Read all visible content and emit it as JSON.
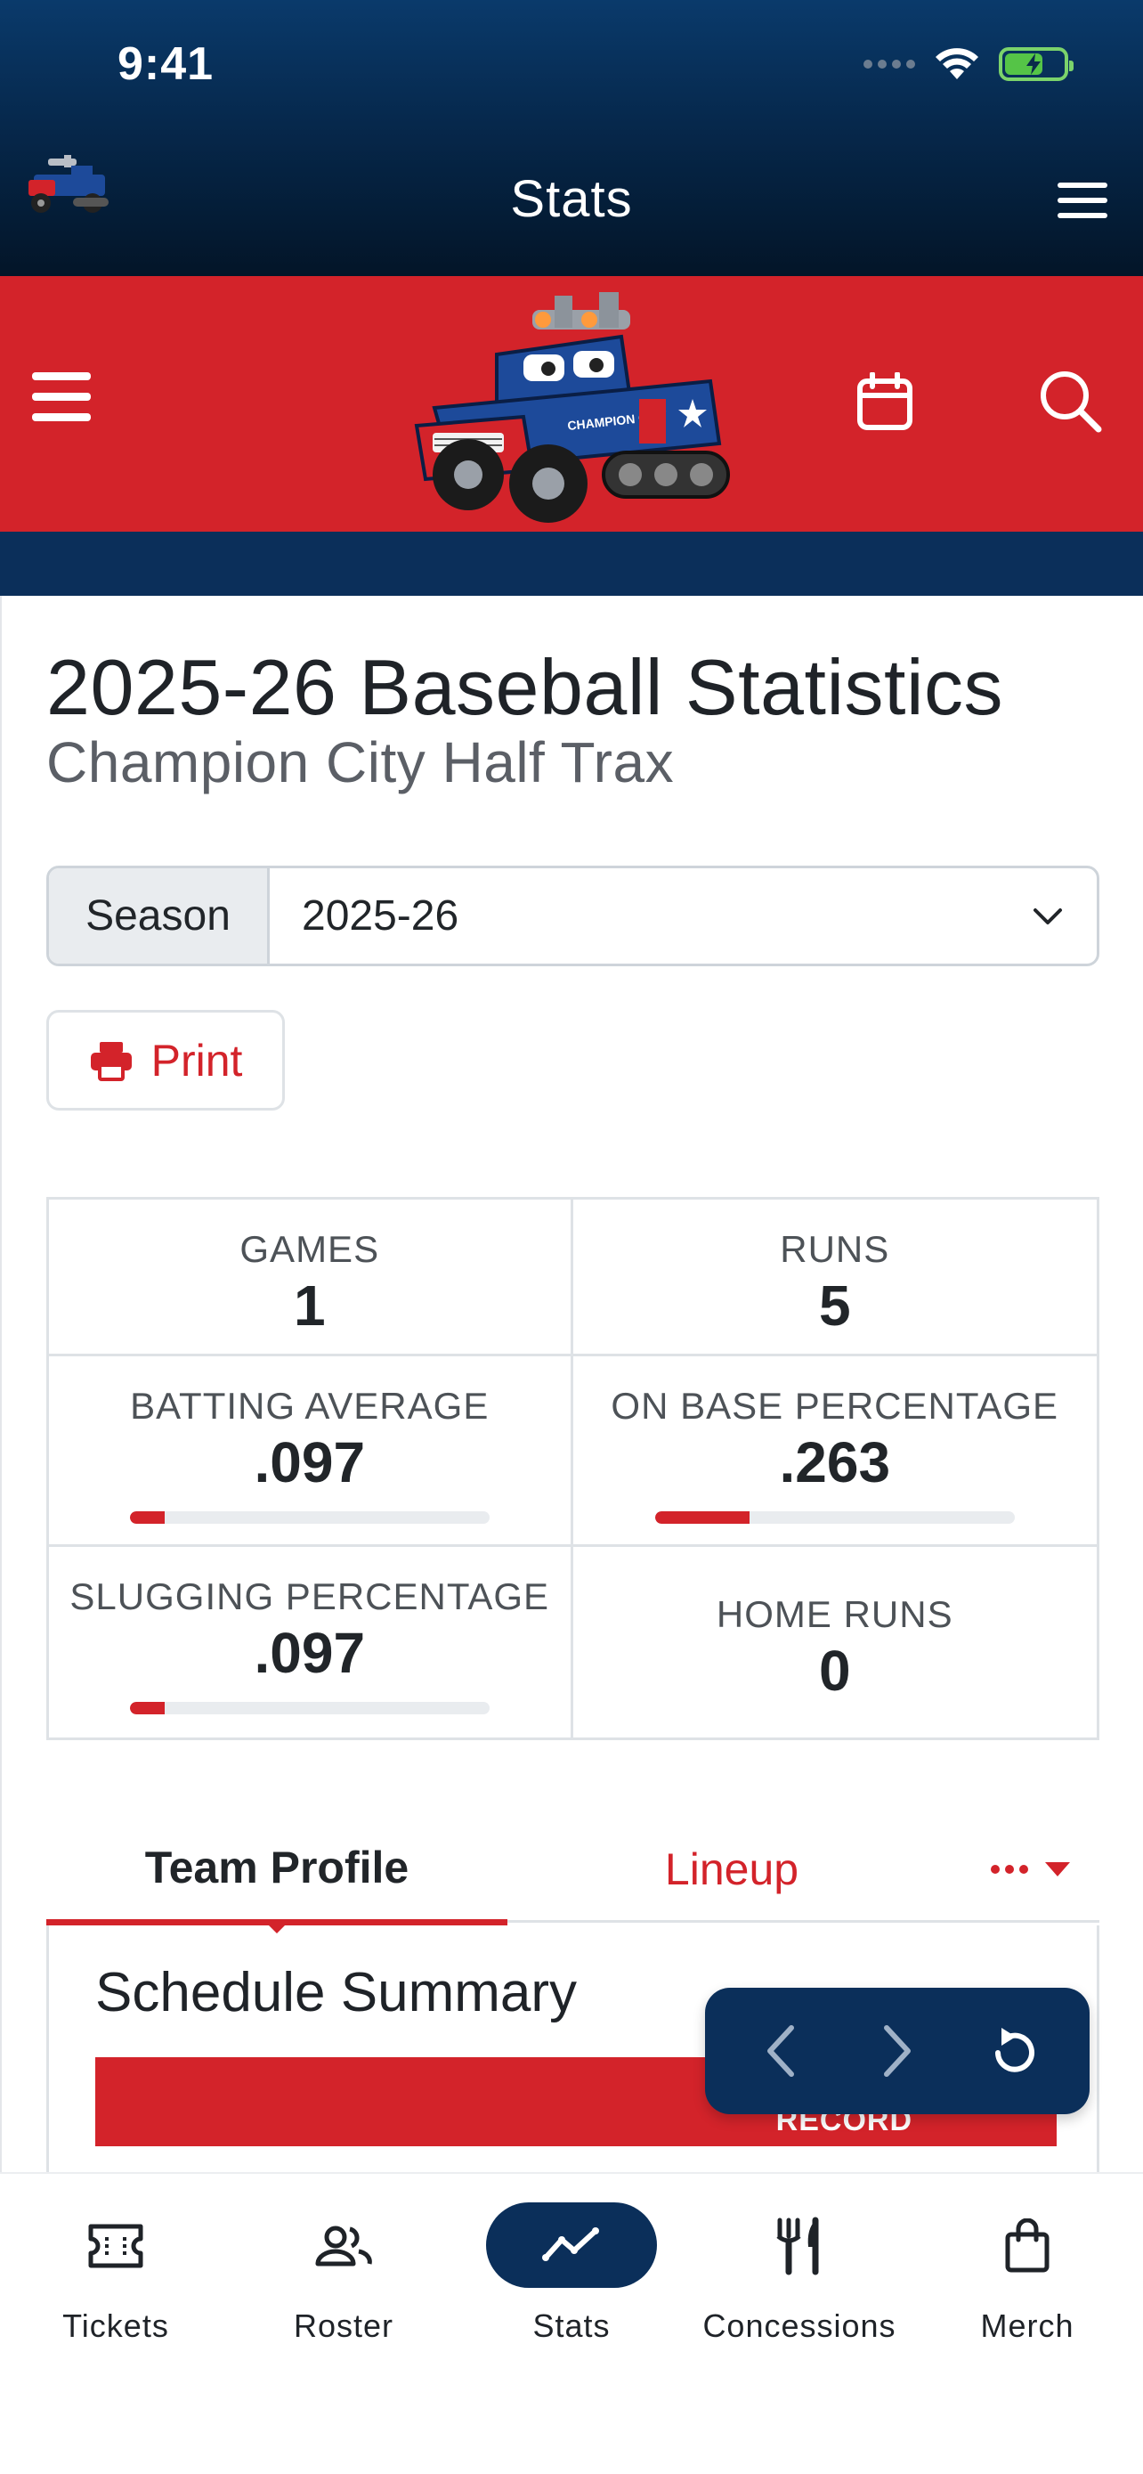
{
  "status_bar": {
    "time": "9:41"
  },
  "app_header": {
    "title": "Stats"
  },
  "page": {
    "title": "2025-26 Baseball Statistics",
    "subtitle": "Champion City Half Trax"
  },
  "season_filter": {
    "label": "Season",
    "selected": "2025-26"
  },
  "print_button": {
    "label": "Print"
  },
  "stats": [
    {
      "label": "GAMES",
      "value": "1"
    },
    {
      "label": "RUNS",
      "value": "5"
    },
    {
      "label": "BATTING AVERAGE",
      "value": ".097",
      "progress": 0.097
    },
    {
      "label": "ON BASE PERCENTAGE",
      "value": ".263",
      "progress": 0.263
    },
    {
      "label": "SLUGGING PERCENTAGE",
      "value": ".097",
      "progress": 0.097
    },
    {
      "label": "HOME RUNS",
      "value": "0"
    }
  ],
  "tabs": {
    "active": "Team Profile",
    "second": "Lineup",
    "more_icon": "ellipsis-dropdown-icon"
  },
  "schedule_card": {
    "title": "Schedule Summary",
    "record_header": "RECORD"
  },
  "bottom_nav": [
    {
      "label": "Tickets",
      "icon": "ticket-icon"
    },
    {
      "label": "Roster",
      "icon": "people-icon"
    },
    {
      "label": "Stats",
      "icon": "chart-line-icon",
      "active": true
    },
    {
      "label": "Concessions",
      "icon": "utensils-icon"
    },
    {
      "label": "Merch",
      "icon": "shopping-bag-icon"
    }
  ],
  "colors": {
    "brand_red": "#d3232a",
    "brand_navy": "#0b2f5a"
  }
}
